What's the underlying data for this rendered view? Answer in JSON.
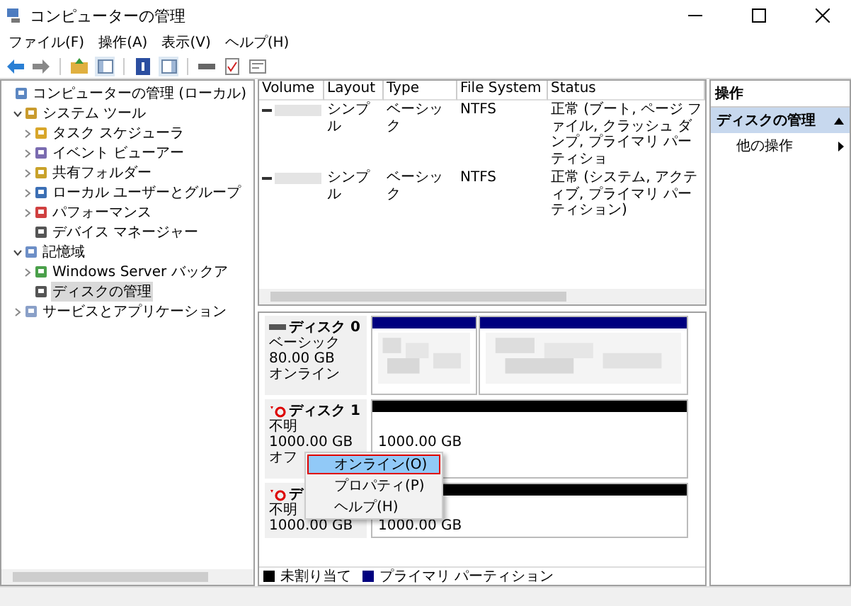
{
  "window": {
    "title": "コンピューターの管理"
  },
  "menu": [
    "ファイル(F)",
    "操作(A)",
    "表示(V)",
    "ヘルプ(H)"
  ],
  "tree": [
    {
      "label": "コンピューターの管理 (ローカル)",
      "selected": false,
      "children": [
        {
          "label": "システム ツール",
          "expanded": true,
          "selected": false,
          "children": [
            {
              "label": "タスク スケジューラ",
              "expanded": false,
              "selected": false
            },
            {
              "label": "イベント ビューアー",
              "expanded": false,
              "selected": false
            },
            {
              "label": "共有フォルダー",
              "expanded": false,
              "selected": false
            },
            {
              "label": "ローカル ユーザーとグループ",
              "expanded": false,
              "selected": false
            },
            {
              "label": "パフォーマンス",
              "expanded": false,
              "selected": false
            },
            {
              "label": "デバイス マネージャー",
              "selected": false
            }
          ]
        },
        {
          "label": "記憶域",
          "expanded": true,
          "selected": false,
          "children": [
            {
              "label": "Windows Server バックア",
              "expanded": false,
              "selected": false
            },
            {
              "label": "ディスクの管理",
              "selected": true
            }
          ]
        },
        {
          "label": "サービスとアプリケーション",
          "expanded": false,
          "selected": false
        }
      ]
    }
  ],
  "table": {
    "columns": [
      "Volume",
      "Layout",
      "Type",
      "File System",
      "Status"
    ],
    "rows": [
      {
        "layout": "シンプル",
        "type": "ベーシック",
        "file_system": "NTFS",
        "status": "正常 (ブート, ページ ファイル, クラッシュ ダンプ, プライマリ パーティショ"
      },
      {
        "layout": "シンプル",
        "type": "ベーシック",
        "file_system": "NTFS",
        "status": "正常 (システム, アクティブ, プライマリ パーティション)"
      }
    ]
  },
  "disks": [
    {
      "name": "ディスク 0",
      "kind": "online",
      "lines": [
        "ベーシック",
        "80.00 GB",
        "オンライン"
      ],
      "partitions": [
        {
          "kind": "blurred",
          "color": "#00007f"
        },
        {
          "kind": "blurred",
          "color": "#00007f"
        }
      ]
    },
    {
      "name": "ディスク 1",
      "kind": "offline",
      "lines": [
        "不明",
        "1000.00 GB",
        "オフ"
      ],
      "partitions": [
        {
          "kind": "sized",
          "color": "#000000",
          "size": "1000.00 GB"
        }
      ]
    },
    {
      "name": "デ",
      "kind": "offline",
      "lines": [
        "不明",
        "1000.00 GB"
      ],
      "partitions": [
        {
          "kind": "sized",
          "color": "#000000",
          "size": "1000.00 GB"
        }
      ]
    }
  ],
  "context_menu": [
    {
      "label": "オンライン(O)",
      "selected": true
    },
    {
      "label": "プロパティ(P)",
      "selected": false
    },
    {
      "label": "ヘルプ(H)",
      "selected": false
    }
  ],
  "legend": [
    {
      "label": "未割り当て",
      "color": "#000000"
    },
    {
      "label": "プライマリ パーティション",
      "color": "#00007f"
    }
  ],
  "actions": {
    "title": "操作",
    "section": {
      "label": "ディスクの管理",
      "expanded": true
    },
    "items": [
      "他の操作"
    ]
  }
}
